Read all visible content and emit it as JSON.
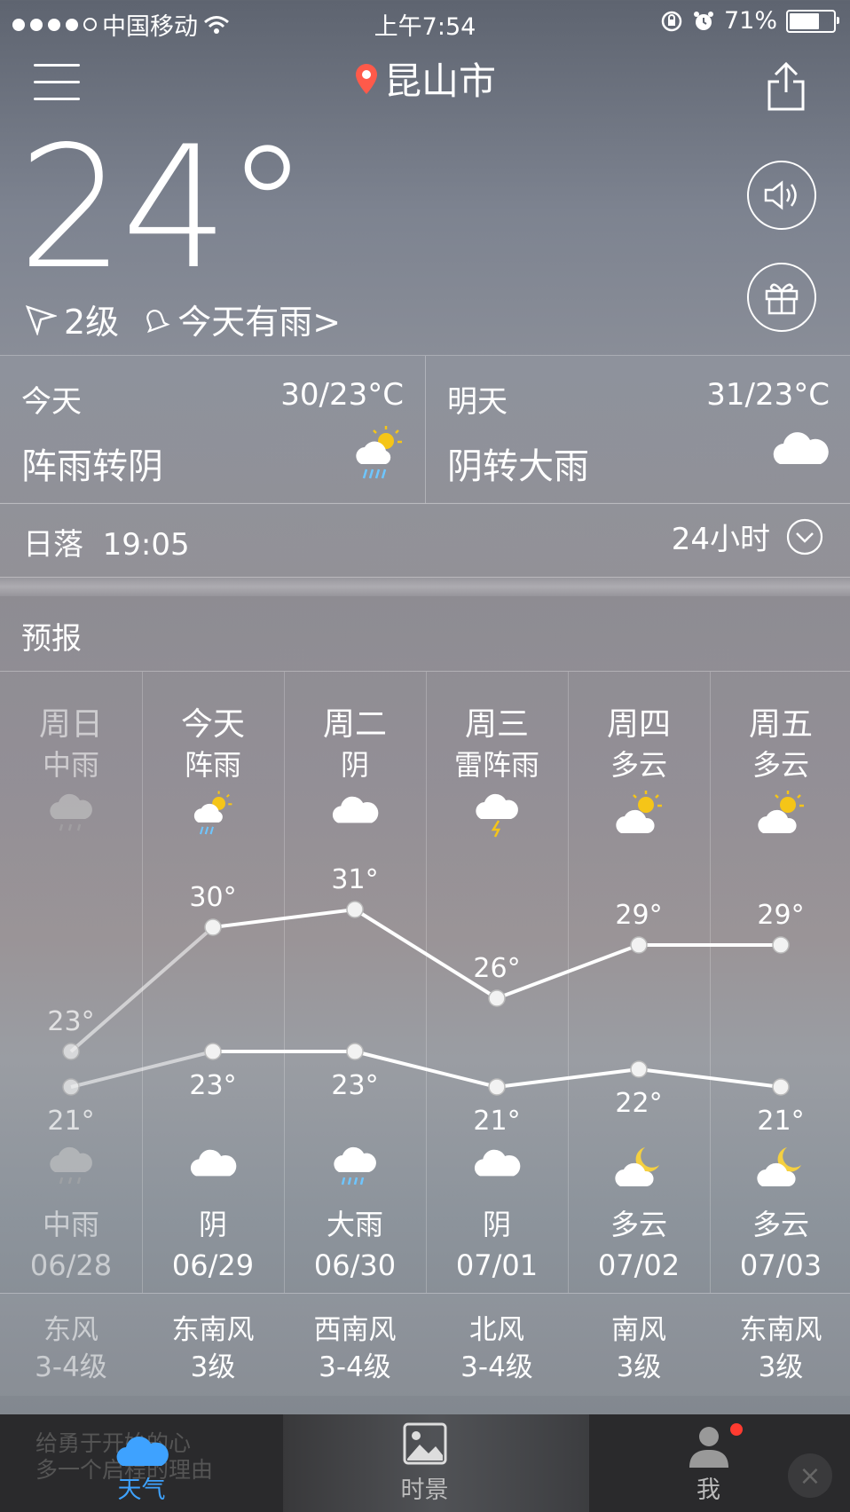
{
  "status_bar": {
    "carrier": "中国移动",
    "time": "上午7:54",
    "battery": "71%",
    "battery_level": 0.71
  },
  "header": {
    "city": "昆山市",
    "icons": [
      "menu-icon",
      "location-pin-icon",
      "share-icon"
    ]
  },
  "current": {
    "temp": "24°",
    "wind_level": "2级",
    "alert": "今天有雨>"
  },
  "today": {
    "label": "今天",
    "range": "30/23°C",
    "desc": "阵雨转阴",
    "icon": "shower-sun-icon"
  },
  "tomorrow": {
    "label": "明天",
    "range": "31/23°C",
    "desc": "阴转大雨",
    "icon": "cloud-icon"
  },
  "sunset": {
    "label": "日落",
    "time": "19:05",
    "hourly_label": "24小时"
  },
  "forecast": {
    "title": "预报",
    "days": [
      {
        "weekday": "周日",
        "day_desc": "中雨",
        "high": "23°",
        "low": "21°",
        "night_desc": "中雨",
        "date": "06/28",
        "wind_dir": "东风",
        "wind_level": "3-4级",
        "past": true
      },
      {
        "weekday": "今天",
        "day_desc": "阵雨",
        "high": "30°",
        "low": "23°",
        "night_desc": "阴",
        "date": "06/29",
        "wind_dir": "东南风",
        "wind_level": "3级"
      },
      {
        "weekday": "周二",
        "day_desc": "阴",
        "high": "31°",
        "low": "23°",
        "night_desc": "大雨",
        "date": "06/30",
        "wind_dir": "西南风",
        "wind_level": "3-4级"
      },
      {
        "weekday": "周三",
        "day_desc": "雷阵雨",
        "high": "26°",
        "low": "21°",
        "night_desc": "阴",
        "date": "07/01",
        "wind_dir": "北风",
        "wind_level": "3-4级"
      },
      {
        "weekday": "周四",
        "day_desc": "多云",
        "high": "29°",
        "low": "22°",
        "night_desc": "多云",
        "date": "07/02",
        "wind_dir": "南风",
        "wind_level": "3级"
      },
      {
        "weekday": "周五",
        "day_desc": "多云",
        "high": "29°",
        "low": "21°",
        "night_desc": "多云",
        "date": "07/03",
        "wind_dir": "东南风",
        "wind_level": "3级"
      }
    ]
  },
  "chart_data": {
    "type": "line",
    "categories": [
      "06/28",
      "06/29",
      "06/30",
      "07/01",
      "07/02",
      "07/03"
    ],
    "series": [
      {
        "values": [
          23,
          30,
          31,
          26,
          29,
          29
        ]
      },
      {
        "values": [
          21,
          23,
          23,
          21,
          22,
          21
        ]
      }
    ]
  },
  "tabbar": {
    "tabs": [
      {
        "label": "天气",
        "icon": "cloud-icon",
        "active": true
      },
      {
        "label": "时景",
        "icon": "image-icon"
      },
      {
        "label": "我",
        "icon": "person-icon"
      }
    ],
    "ad_text_line1": "给勇于开始的心",
    "ad_text_line2": "多一个启程的理由"
  },
  "colors": {
    "accent": "#3ea2ff",
    "sun": "#f5c518",
    "rain": "#6ec6ff",
    "badge": "#ff3b30"
  }
}
